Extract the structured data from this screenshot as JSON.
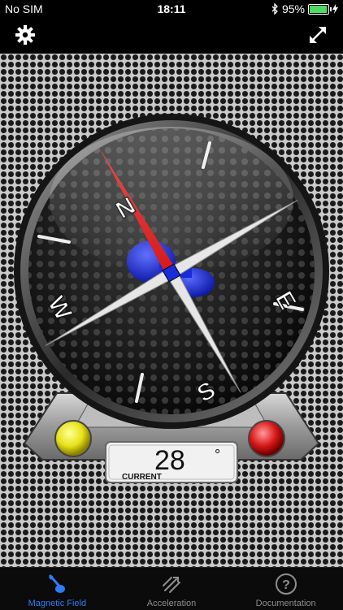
{
  "status": {
    "carrier": "No SIM",
    "time": "18:11",
    "battery": "95%",
    "battery_level": 0.95
  },
  "toolbar": {
    "settings_icon": "gear-icon",
    "fullscreen_icon": "expand-icon"
  },
  "compass": {
    "directions": {
      "north": "N",
      "east": "E",
      "south": "S",
      "west": "W"
    },
    "reading_value": "28",
    "reading_unit": "°",
    "reading_label": "CURRENT",
    "left_light": "#e8e21a",
    "right_light": "#d81818",
    "needle_color": "#d81818",
    "magnet_color": "#1a2bd8"
  },
  "tabs": [
    {
      "label": "Magnetic Field",
      "icon": "magnet-icon",
      "active": true
    },
    {
      "label": "Acceleration",
      "icon": "acceleration-icon",
      "active": false
    },
    {
      "label": "Documentation",
      "icon": "help-icon",
      "active": false
    }
  ],
  "colors": {
    "accent": "#2f7df6",
    "inactive": "#8e8e8e"
  }
}
